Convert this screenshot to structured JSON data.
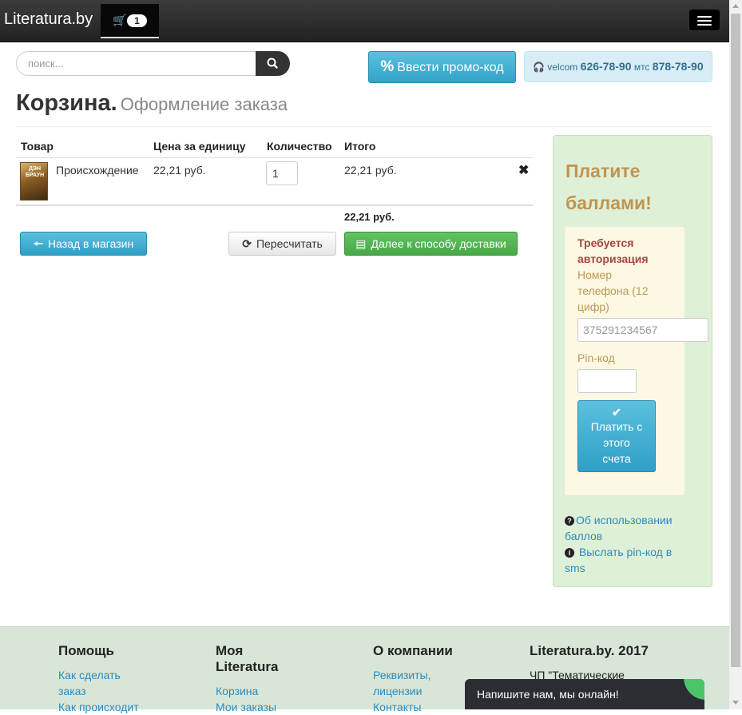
{
  "navbar": {
    "brand": "Literatura.by",
    "cart_count": "1"
  },
  "search": {
    "placeholder": "поиск..."
  },
  "promo": {
    "icon": "%",
    "label": "Ввести промо-код"
  },
  "contact": {
    "op1": "velcom",
    "phone1": "626-78-90",
    "op2": "мтс",
    "phone2": "878-78-90"
  },
  "page": {
    "title": "Корзина.",
    "subtitle": "Оформление заказа"
  },
  "cart": {
    "headers": [
      "Товар",
      "Цена за единицу",
      "Количество",
      "Итого"
    ],
    "items": [
      {
        "cover_text": "ДЭН БРАУН",
        "name": "Происхождение",
        "unit_price": "22,21 руб.",
        "quantity": "1",
        "total": "22,21 руб."
      }
    ],
    "grand_total": "22,21 руб."
  },
  "buttons": {
    "back": "Назад в магазин",
    "recalc": "Пересчитать",
    "next": "Далее к способу доставки"
  },
  "points": {
    "title": "Платите баллами!",
    "auth_required": "Требуется авторизация",
    "phone_label": "Номер телефона (12 цифр)",
    "phone_placeholder": "375291234567",
    "pin_label": "Pin-код",
    "pay_label": "Платить с этого счета",
    "link_about": "Об использовании баллов",
    "link_pin": "Выслать pin-код в sms"
  },
  "footer": {
    "columns": [
      {
        "title": "Помощь",
        "items": [
          "Как сделать заказ",
          "Как происходит"
        ]
      },
      {
        "title": "Моя Literatura",
        "items": [
          "Корзина",
          "Мои заказы"
        ]
      },
      {
        "title": "О компании",
        "items": [
          "Реквизиты, лицензии",
          "Контакты"
        ]
      },
      {
        "title": "Literatura.by. 2017",
        "items": [
          "ЧП \"Тематические"
        ]
      }
    ]
  },
  "chat": {
    "label": "Напишите нам, мы онлайн!"
  },
  "colors": {
    "info": "#5bc0de",
    "success": "#5cb85c",
    "link": "#2a8bc1",
    "panel": "#dff0d8"
  }
}
